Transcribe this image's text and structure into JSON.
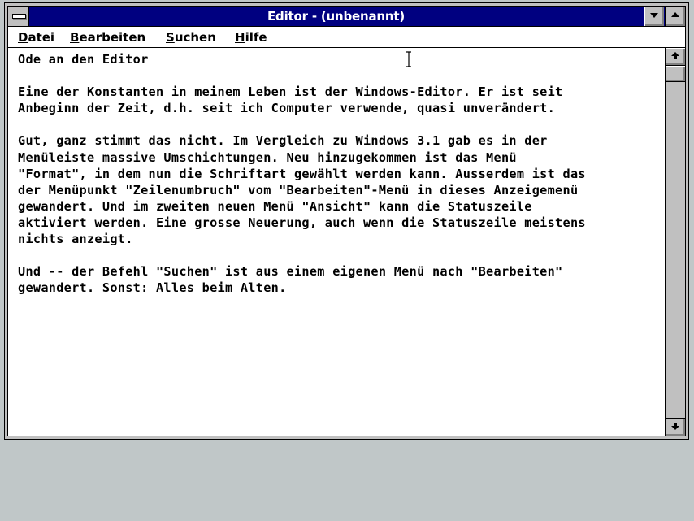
{
  "window": {
    "title": "Editor - (unbenannt)"
  },
  "menu": {
    "items": [
      {
        "accel": "D",
        "rest": "atei"
      },
      {
        "accel": "B",
        "rest": "earbeiten"
      },
      {
        "accel": "S",
        "rest": "uchen"
      },
      {
        "accel": "H",
        "rest": "ilfe"
      }
    ]
  },
  "document": {
    "text": "Ode an den Editor\n\nEine der Konstanten in meinem Leben ist der Windows-Editor. Er ist seit\nAnbeginn der Zeit, d.h. seit ich Computer verwende, quasi unverändert.\n\nGut, ganz stimmt das nicht. Im Vergleich zu Windows 3.1 gab es in der\nMenüleiste massive Umschichtungen. Neu hinzugekommen ist das Menü\n\"Format\", in dem nun die Schriftart gewählt werden kann. Ausserdem ist das\nder Menüpunkt \"Zeilenumbruch\" vom \"Bearbeiten\"-Menü in dieses Anzeigemenü\ngewandert. Und im zweiten neuen Menü \"Ansicht\" kann die Statuszeile\naktiviert werden. Eine grosse Neuerung, auch wenn die Statuszeile meistens\nnichts anzeigt.\n\nUnd -- der Befehl \"Suchen\" ist aus einem eigenen Menü nach \"Bearbeiten\"\ngewandert. Sonst: Alles beim Alten."
  },
  "colors": {
    "titlebar": "#000080",
    "desktop": "#c0c7c8",
    "chrome": "#c0c0c0"
  },
  "icons": {
    "system_menu": "system-menu-icon",
    "minimize": "minimize-arrow-icon",
    "maximize": "maximize-arrow-icon",
    "scroll_up": "scroll-up-arrow-icon",
    "scroll_down": "scroll-down-arrow-icon",
    "cursor": "ibeam-cursor-icon"
  }
}
